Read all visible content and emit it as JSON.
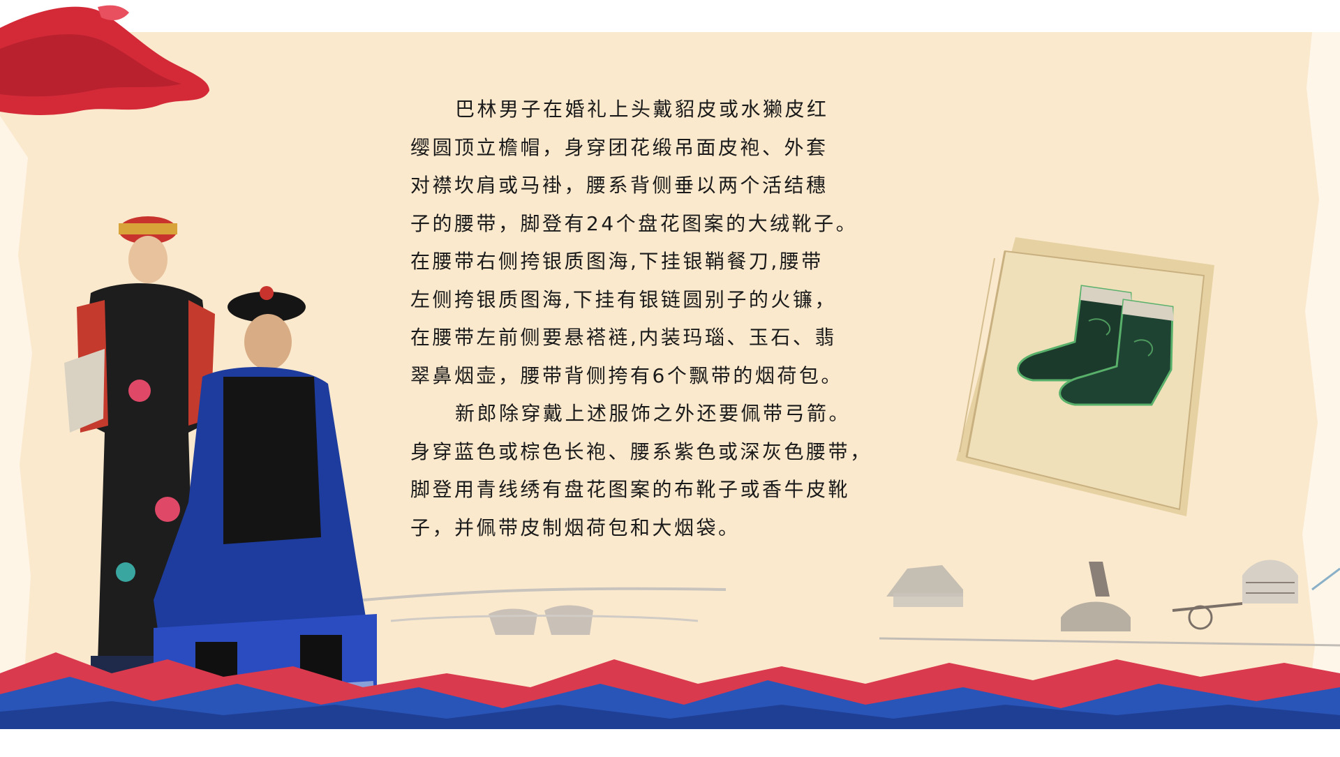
{
  "article": {
    "paragraph1": [
      "巴林男子在婚礼上头戴貂皮或水獭皮红",
      "缨圆顶立檐帽，身穿团花缎吊面皮袍、外套",
      "对襟坎肩或马褂，腰系背侧垂以两个活结穗",
      "子的腰带，脚登有24个盘花图案的大绒靴子。",
      "在腰带右侧挎银质图海,下挂银鞘餐刀,腰带",
      "左侧挎银质图海,下挂有银链圆别子的火镰，",
      "在腰带左前侧要悬褡裢,内装玛瑙、玉石、翡",
      "翠鼻烟壶，腰带背侧挎有6个飘带的烟荷包。"
    ],
    "paragraph2": [
      "新郎除穿戴上述服饰之外还要佩带弓箭。",
      "身穿蓝色或棕色长袍、腰系紫色或深灰色腰带，",
      "脚登用青线绣有盘花图案的布靴子或香牛皮靴",
      "子，并佩带皮制烟荷包和大烟袋。"
    ]
  },
  "colors": {
    "parchment": "#fbe9cd",
    "text": "#1a1a1a",
    "ribbon_red": "#d42a38",
    "mountain_blue": "#2a55b8",
    "mountain_red": "#d93a4e"
  }
}
